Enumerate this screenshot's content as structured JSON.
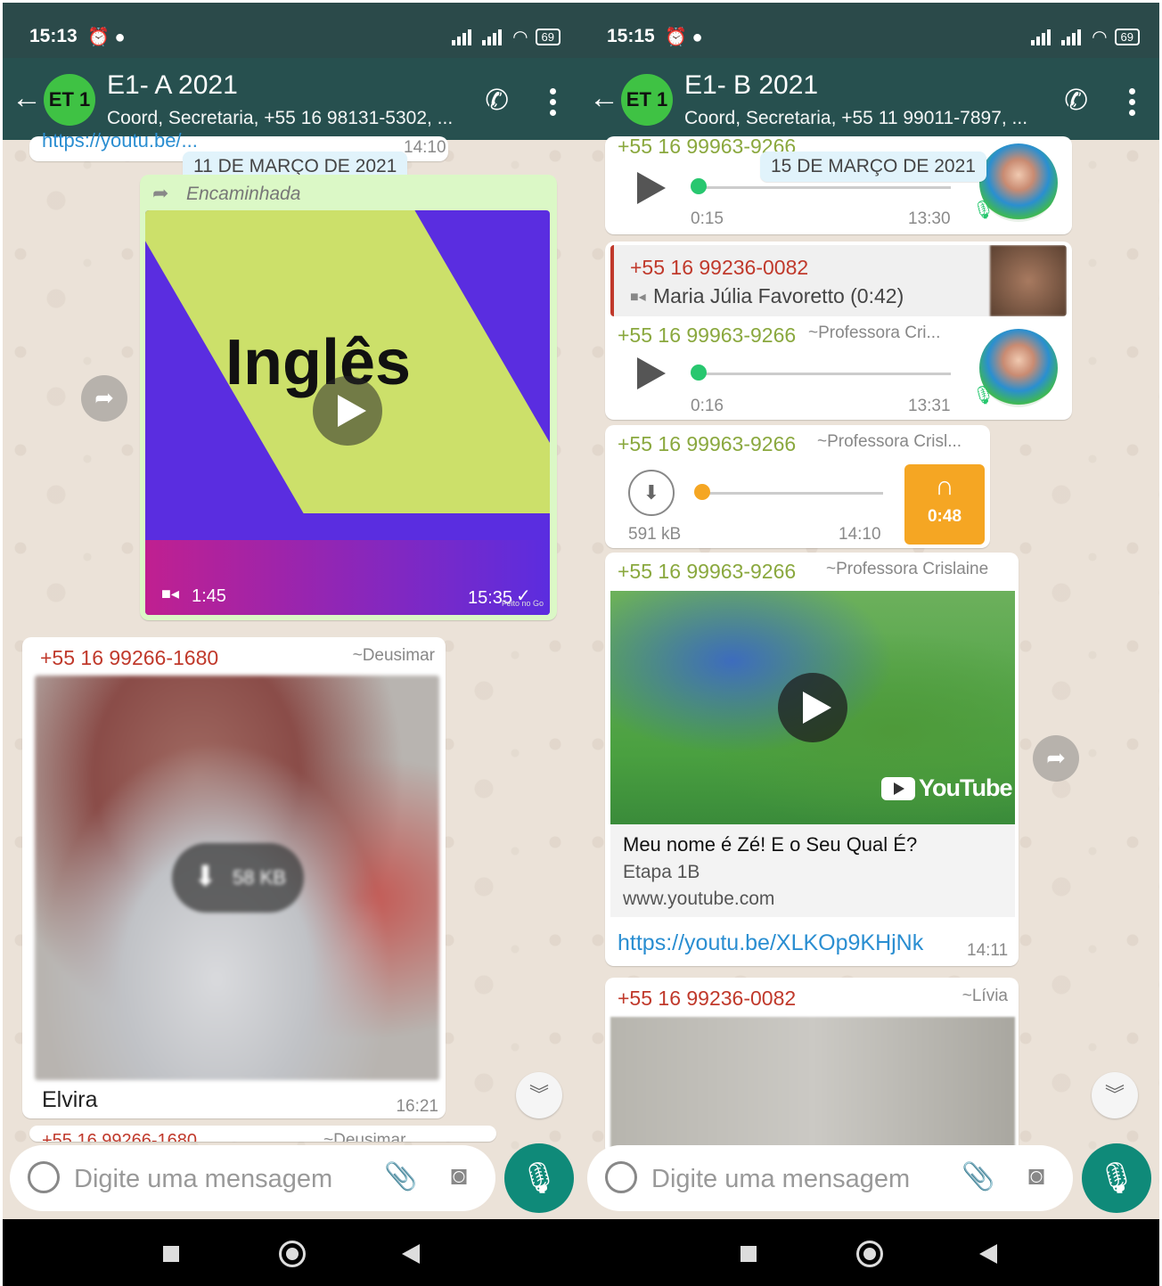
{
  "left": {
    "status": {
      "time": "15:13",
      "battery": "69"
    },
    "header": {
      "avatar": "ET 1",
      "title": "E1- A 2021",
      "subtitle": "Coord, Secretaria, +55 16 98131-5302, ..."
    },
    "date_chip": "11 DE MARÇO DE 2021",
    "partial_link": "https://youtu.be/...",
    "partial_time": "14:10",
    "forwarded": {
      "label": "Encaminhada",
      "image_text": "Inglês",
      "duration": "1:45",
      "time": "15:35",
      "watermark": "Feito no Go"
    },
    "msg1": {
      "sender": "+55 16 99266-1680",
      "nick": "~Deusimar",
      "download": "58 KB",
      "caption": "Elvira",
      "time": "16:21"
    },
    "msg2": {
      "sender": "+55 16 99266-1680",
      "nick": "~Deusimar"
    },
    "input": {
      "placeholder": "Digite uma mensagem"
    }
  },
  "right": {
    "status": {
      "time": "15:15",
      "battery": "69"
    },
    "header": {
      "avatar": "ET 1",
      "title": "E1- B 2021",
      "subtitle": "Coord, Secretaria, +55 11 99011-7897, ..."
    },
    "date_chip": "15 DE MARÇO DE 2021",
    "audio1": {
      "sender": "+55 16 99963-9266",
      "duration": "0:15",
      "time": "13:30"
    },
    "audio2": {
      "reply_sender": "+55 16 99236-0082",
      "reply_text": "Maria Júlia Favoretto (0:42)",
      "sender": "+55 16 99963-9266",
      "nick": "~Professora Cri...",
      "duration": "0:16",
      "time": "13:31"
    },
    "audio3": {
      "sender": "+55 16 99963-9266",
      "nick": "~Professora Crisl...",
      "size": "591 kB",
      "time": "14:10",
      "length": "0:48"
    },
    "link_msg": {
      "sender": "+55 16 99963-9266",
      "nick": "~Professora Crislaine",
      "brand": "YouTube",
      "title": "Meu nome é Zé! E o Seu Qual É?",
      "desc": "Etapa 1B",
      "domain": "www.youtube.com",
      "url": "https://youtu.be/XLKOp9KHjNk",
      "time": "14:11"
    },
    "msg_livia": {
      "sender": "+55 16 99236-0082",
      "nick": "~Lívia"
    },
    "input": {
      "placeholder": "Digite uma mensagem"
    }
  },
  "colors": {
    "header": "#27504f",
    "status": "#2b4a4a",
    "accent": "#0f8a79",
    "sender_red": "#c0392b",
    "sender_green": "#8aa83e",
    "mic_orange": "#f5a623"
  }
}
